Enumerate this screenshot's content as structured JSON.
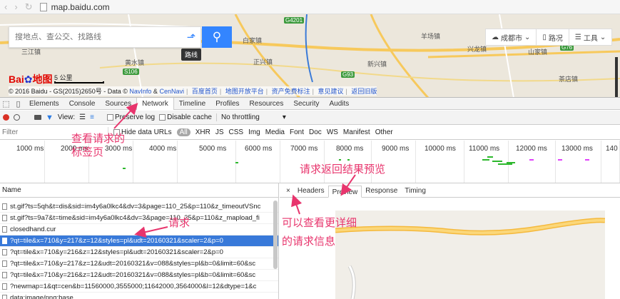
{
  "browser": {
    "url": "map.baidu.com"
  },
  "map": {
    "search_placeholder": "搜地点、查公交、找路线",
    "route_tip": "路线",
    "city": "成都市",
    "traffic": "路况",
    "tools": "工具",
    "places": [
      "三江镇",
      "白家镇",
      "黄水镇",
      "正兴镇",
      "兴龙镇",
      "山家镇",
      "新兴镇",
      "茶店镇",
      "羊场镇"
    ],
    "roads": [
      "G4201",
      "S106",
      "G76",
      "G93"
    ],
    "scale": "5 公里",
    "logo_text": "Bai",
    "logo_suffix": "地图",
    "copyright": "© 2016 Baidu - GS(2015)2650号 - Data ©",
    "copyright_links": [
      "NavInfo",
      "CenNavi",
      "百度首页",
      "地图开放平台",
      "资产免费标注",
      "意见建议",
      "返回旧版"
    ],
    "amp": "&"
  },
  "devtools": {
    "tabs": [
      "Elements",
      "Console",
      "Sources",
      "Network",
      "Timeline",
      "Profiles",
      "Resources",
      "Security",
      "Audits"
    ],
    "active_tab": "Network",
    "toolbar": {
      "view": "View:",
      "preserve_log": "Preserve log",
      "disable_cache": "Disable cache",
      "throttle": "No throttling"
    },
    "filter": {
      "placeholder": "Filter",
      "hide_data": "Hide data URLs",
      "all": "All",
      "types": [
        "XHR",
        "JS",
        "CSS",
        "Img",
        "Media",
        "Font",
        "Doc",
        "WS",
        "Manifest",
        "Other"
      ]
    },
    "timeline_ticks": [
      "1000 ms",
      "2000 ms",
      "3000 ms",
      "4000 ms",
      "5000 ms",
      "6000 ms",
      "7000 ms",
      "8000 ms",
      "9000 ms",
      "10000 ms",
      "11000 ms",
      "12000 ms",
      "13000 ms",
      "140"
    ],
    "name_header": "Name",
    "rows": [
      "st.gif?ts=5qh&t=dis&sid=im4y6a0lkc4&dv=3&page=110_25&p=110&z_timeoutVSnc",
      "st.gif?ts=9a7&t=time&sid=im4y6a0lkc4&dv=3&page=110_25&p=110&z_mapload_fi",
      "closedhand.cur",
      "?qt=tile&x=710&y=217&z=12&styles=pl&udt=20160321&scaler=2&p=0",
      "?qt=tile&x=710&y=216&z=12&styles=pl&udt=20160321&scaler=2&p=0",
      "?qt=tile&x=710&y=217&z=12&udt=20160321&v=088&styles=pl&b=0&limit=60&sc",
      "?qt=tile&x=710&y=216&z=12&udt=20160321&v=088&styles=pl&b=0&limit=60&sc",
      "?newmap=1&qt=cen&b=11560000,3555000;11642000,3564000&l=12&dtype=1&c",
      "data:image/png;base..."
    ],
    "selected_row": 3,
    "detail": {
      "close": "×",
      "tabs": [
        "Headers",
        "Preview",
        "Response",
        "Timing"
      ],
      "active": "Preview"
    }
  },
  "annotations": {
    "network_tab_l1": "查看请求的",
    "network_tab_l2": "标签页",
    "request": "请求",
    "preview": "请求返回结果预览",
    "detail_l1": "可以查看更详细",
    "detail_l2": "的请求信息"
  },
  "colors": {
    "accent": "#3385ff",
    "annotation": "#e8356d",
    "selected_row": "#3879d9"
  }
}
